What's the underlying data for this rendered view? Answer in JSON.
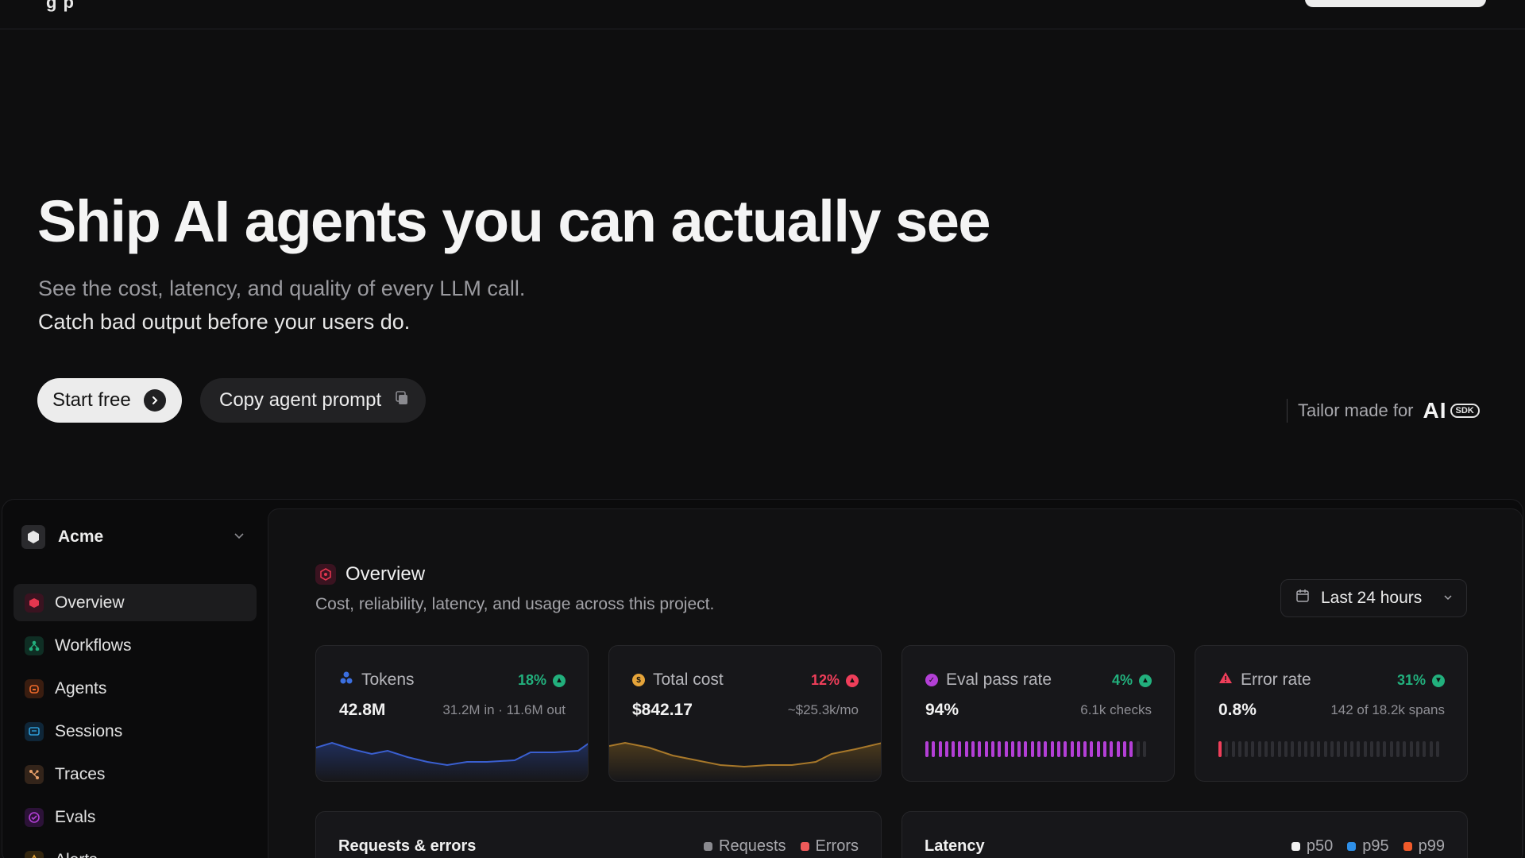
{
  "topbar": {
    "logo_fragment": "g p"
  },
  "hero": {
    "title": "Ship AI agents you can actually see",
    "subtitle_line1": "See the cost, latency, and quality of every LLM call.",
    "subtitle_line2": "Catch bad output before your users do.",
    "start_label": "Start free",
    "copy_label": "Copy agent prompt",
    "tailor_label": "Tailor made for",
    "tailor_brand": "AI",
    "tailor_badge": "SDK"
  },
  "workspace": {
    "name": "Acme"
  },
  "sidebar": {
    "items": [
      {
        "label": "Overview",
        "icon": "overview-icon",
        "color": "#e5364f",
        "active": true
      },
      {
        "label": "Workflows",
        "icon": "workflows-icon",
        "color": "#22b07d"
      },
      {
        "label": "Agents",
        "icon": "agents-icon",
        "color": "#f06a2a"
      },
      {
        "label": "Sessions",
        "icon": "sessions-icon",
        "color": "#2e9bd6"
      },
      {
        "label": "Traces",
        "icon": "traces-icon",
        "color": "#e8a06a"
      },
      {
        "label": "Evals",
        "icon": "evals-icon",
        "color": "#b33fd6"
      },
      {
        "label": "Alerts",
        "icon": "alerts-icon",
        "color": "#e5a43a"
      }
    ]
  },
  "overview": {
    "title": "Overview",
    "subtitle": "Cost, reliability, latency, and usage across this project.",
    "range_label": "Last 24 hours"
  },
  "cards": [
    {
      "title": "Tokens",
      "delta": "18%",
      "delta_color": "#22b07d",
      "value": "42.8M",
      "meta": "31.2M in · 11.6M out",
      "icon_color": "#3b6fe0"
    },
    {
      "title": "Total cost",
      "delta": "12%",
      "delta_color": "#ef3e5a",
      "value": "$842.17",
      "meta": "~$25.3k/mo",
      "icon_color": "#e5a43a"
    },
    {
      "title": "Eval pass rate",
      "delta": "4%",
      "delta_color": "#22b07d",
      "value": "94%",
      "meta": "6.1k checks",
      "icon_color": "#b33fd6",
      "pass_fraction": 0.94
    },
    {
      "title": "Error rate",
      "delta": "31%",
      "delta_color": "#22b07d",
      "value": "0.8%",
      "meta": "142 of 18.2k spans",
      "icon_color": "#ef3e5a",
      "error_fraction": 0.008
    }
  ],
  "panels": {
    "requests": {
      "title": "Requests & errors",
      "legend": [
        {
          "label": "Requests",
          "color": "#8a8a8f"
        },
        {
          "label": "Errors",
          "color": "#ef5a5a"
        }
      ]
    },
    "latency": {
      "title": "Latency",
      "legend": [
        {
          "label": "p50",
          "color": "#f0f0f0"
        },
        {
          "label": "p95",
          "color": "#2e8fe8"
        },
        {
          "label": "p99",
          "color": "#f05a2a"
        }
      ]
    }
  }
}
